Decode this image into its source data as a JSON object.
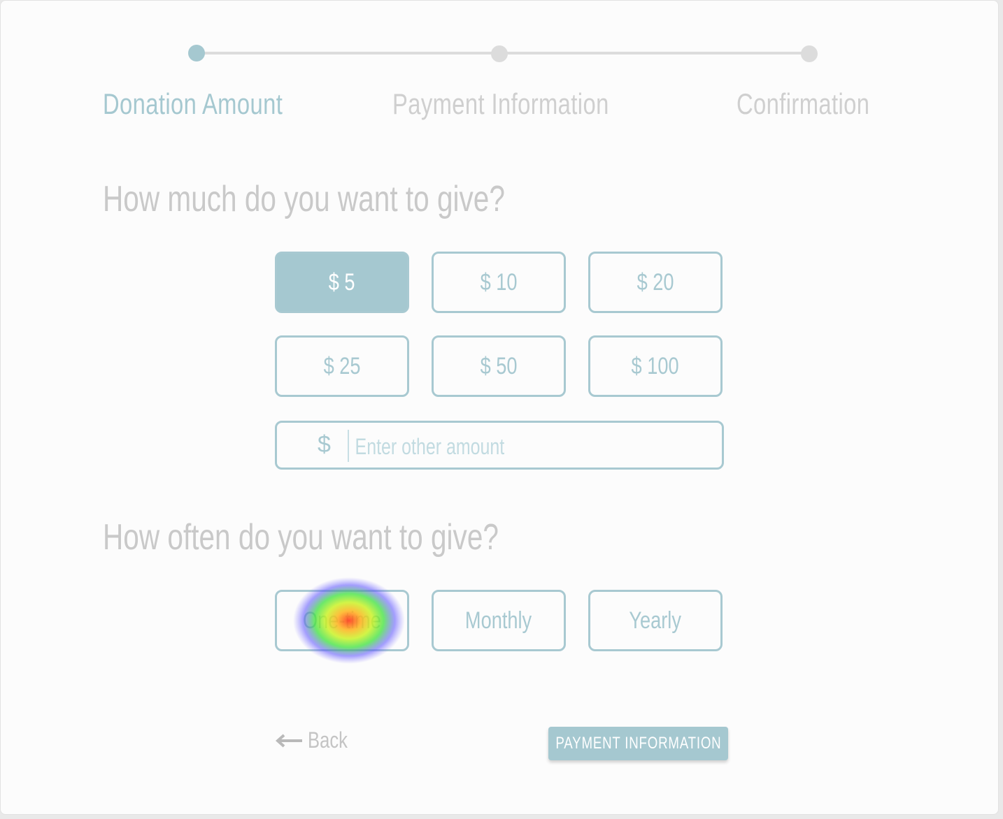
{
  "stepper": {
    "steps": [
      {
        "label": "Donation Amount",
        "active": true
      },
      {
        "label": "Payment Information",
        "active": false
      },
      {
        "label": "Confirmation",
        "active": false
      }
    ]
  },
  "amount_section": {
    "question": "How much do you want to give?",
    "options": [
      "$ 5",
      "$ 10",
      "$ 20",
      "$ 25",
      "$ 50",
      "$ 100"
    ],
    "selected": "$ 5",
    "other": {
      "currency_symbol": "$",
      "placeholder": "Enter other amount",
      "value": ""
    }
  },
  "frequency_section": {
    "question": "How often do you want to give?",
    "options": [
      "One-time",
      "Monthly",
      "Yearly"
    ]
  },
  "footer": {
    "back_label": "Back",
    "next_label": "PAYMENT INFORMATION"
  },
  "colors": {
    "accent": "#a5c8d0",
    "inactive": "#dcdcdc",
    "text_muted": "#c9c9c9"
  },
  "icons": {
    "back": "arrow-left-icon"
  }
}
